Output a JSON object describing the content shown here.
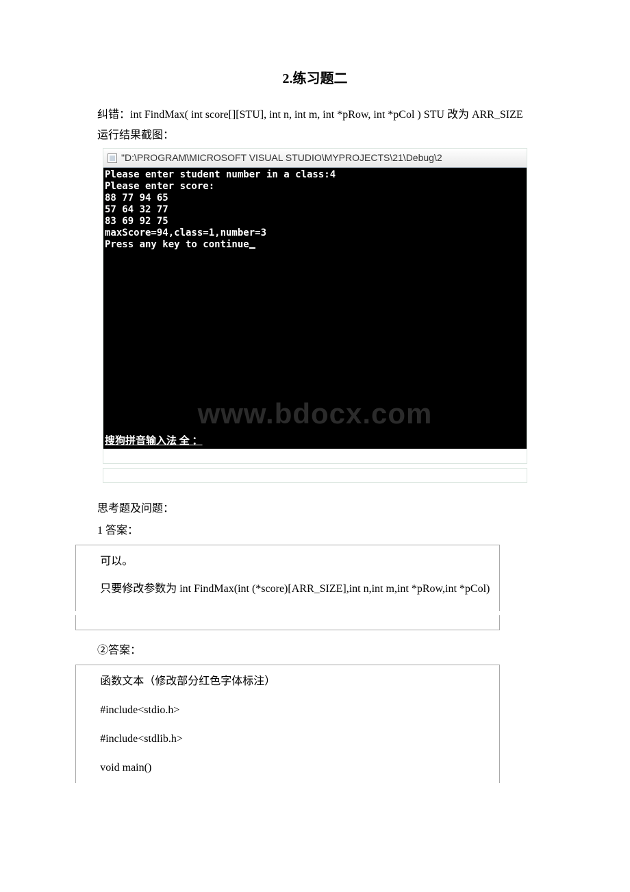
{
  "title": "2.练习题二",
  "paragraphs": {
    "correction": "纠错：int FindMax( int score[][STU], int n, int m, int *pRow, int *pCol )  STU 改为 ARR_SIZE",
    "runCaption": "运行结果截图："
  },
  "console": {
    "titlebar": "\"D:\\PROGRAM\\MICROSOFT VISUAL STUDIO\\MYPROJECTS\\21\\Debug\\2",
    "lines": [
      "Please enter student number in a class:4",
      "Please enter score:",
      "88 77 94 65",
      "57 64 32 77",
      "83 69 92 75",
      "maxScore=94,class=1,number=3",
      "Press any key to continue"
    ],
    "ime": "搜狗拼音输入法 全 ：",
    "watermark": "www.bdocx.com"
  },
  "questions": {
    "header": "思考题及问题：",
    "q1label": "1 答案：",
    "q1body1": "可以。",
    "q1body2": "只要修改参数为 int FindMax(int (*score)[ARR_SIZE],int n,int m,int *pRow,int *pCol)",
    "q2label": "②答案：",
    "q2lines": [
      "函数文本（修改部分红色字体标注）",
      "#include<stdio.h>",
      "#include<stdlib.h>",
      "void main()"
    ]
  }
}
